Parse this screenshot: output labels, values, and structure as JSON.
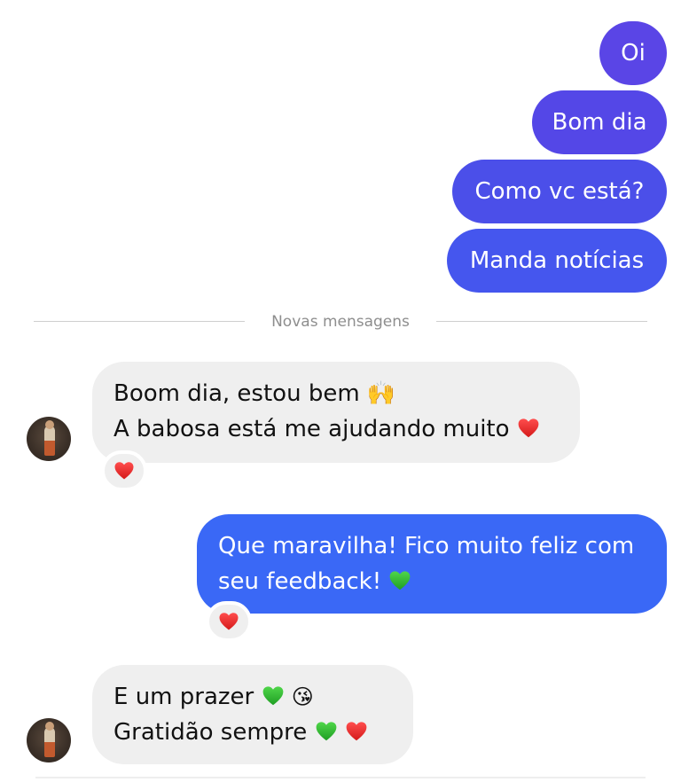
{
  "colors": {
    "outgoing_top": "#5a45e6",
    "outgoing_mid": "#4d4fe9",
    "outgoing_bottom": "#3f66f5",
    "incoming_bg": "#efefef",
    "divider_text": "#8e8e8e"
  },
  "outgoing_group": [
    {
      "text": "Oi"
    },
    {
      "text": "Bom dia"
    },
    {
      "text": "Como vc está?"
    },
    {
      "text": "Manda notícias"
    }
  ],
  "divider": {
    "label": "Novas mensagens"
  },
  "incoming_1": {
    "line1": "Boom dia, estou bem",
    "line1_emoji": "raising-hands-emoji",
    "line2": "A babosa está me ajudando muito",
    "line2_emoji": "red-heart-emoji",
    "reaction": "red-heart-emoji"
  },
  "outgoing_2": {
    "line1": "Que maravilha! Fico muito feliz com",
    "line2": "seu feedback!",
    "line2_emoji": "green-heart-emoji",
    "reaction": "red-heart-emoji"
  },
  "incoming_2": {
    "line1": "E um prazer",
    "line1_emojis": [
      "green-heart-emoji",
      "face-blowing-kiss-emoji"
    ],
    "line2": "Gratidão sempre",
    "line2_emojis": [
      "green-heart-emoji",
      "red-heart-emoji"
    ]
  }
}
